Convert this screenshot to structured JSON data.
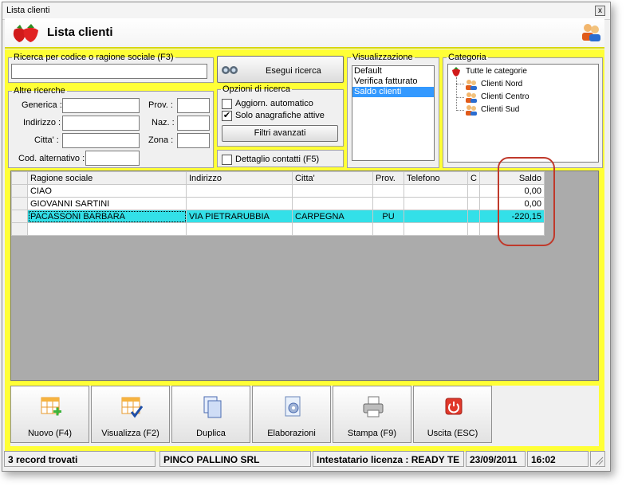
{
  "window": {
    "title": "Lista clienti",
    "close": "x"
  },
  "header": {
    "title": "Lista clienti"
  },
  "search": {
    "code_legend": "Ricerca per codice o ragione sociale (F3)",
    "code_value": "",
    "run_button": "Esegui ricerca",
    "other_legend": "Altre ricerche",
    "fields": {
      "generica": "Generica :",
      "indirizzo": "Indirizzo :",
      "citta": "Citta' :",
      "cod_alt": "Cod. alternativo :",
      "prov": "Prov. :",
      "naz": "Naz. :",
      "zona": "Zona :"
    },
    "options_legend": "Opzioni di ricerca",
    "opt_aggiorn": "Aggiorn. automatico",
    "opt_solo": "Solo anagrafiche attive",
    "filters_button": "Filtri avanzati",
    "dettaglio": "Dettaglio contatti (F5)"
  },
  "visualizzazione": {
    "legend": "Visualizzazione",
    "items": [
      "Default",
      "Verifica fatturato",
      "Saldo clienti"
    ],
    "selected": "Saldo clienti"
  },
  "categoria": {
    "legend": "Categoria",
    "root": "Tutte le categorie",
    "children": [
      "Clienti Nord",
      "Clienti Centro",
      "Clienti Sud"
    ]
  },
  "grid": {
    "columns": [
      "Ragione sociale",
      "Indirizzo",
      "Citta'",
      "Prov.",
      "Telefono",
      "C",
      "Saldo"
    ],
    "rows": [
      [
        "CIAO",
        "",
        "",
        "",
        "",
        "",
        "0,00"
      ],
      [
        "GIOVANNI SARTINI",
        "",
        "",
        "",
        "",
        "",
        "0,00"
      ],
      [
        "PACASSONI BARBARA",
        "VIA PIETRARUBBIA",
        "CARPEGNA",
        "PU",
        "",
        "",
        "-220,15"
      ],
      [
        "",
        "",
        "",
        "",
        "",
        "",
        ""
      ]
    ],
    "highlight_row": 2
  },
  "toolbar": {
    "buttons": [
      {
        "label": "Nuovo (F4)",
        "icon": "new-grid-icon"
      },
      {
        "label": "Visualizza (F2)",
        "icon": "view-grid-icon"
      },
      {
        "label": "Duplica",
        "icon": "duplicate-icon"
      },
      {
        "label": "Elaborazioni",
        "icon": "gear-document-icon"
      },
      {
        "label": "Stampa (F9)",
        "icon": "printer-icon"
      },
      {
        "label": "Uscita (ESC)",
        "icon": "exit-icon"
      }
    ]
  },
  "status": {
    "records": "3 record trovati",
    "company": "PINCO PALLINO SRL",
    "license": "Intestatario licenza : READY TE",
    "date": "23/09/2011",
    "time": "16:02"
  },
  "colors": {
    "accent_yellow": "#ffff36",
    "highlight": "#33e0e8",
    "selection": "#3399ff",
    "annotation": "#c0392b"
  }
}
